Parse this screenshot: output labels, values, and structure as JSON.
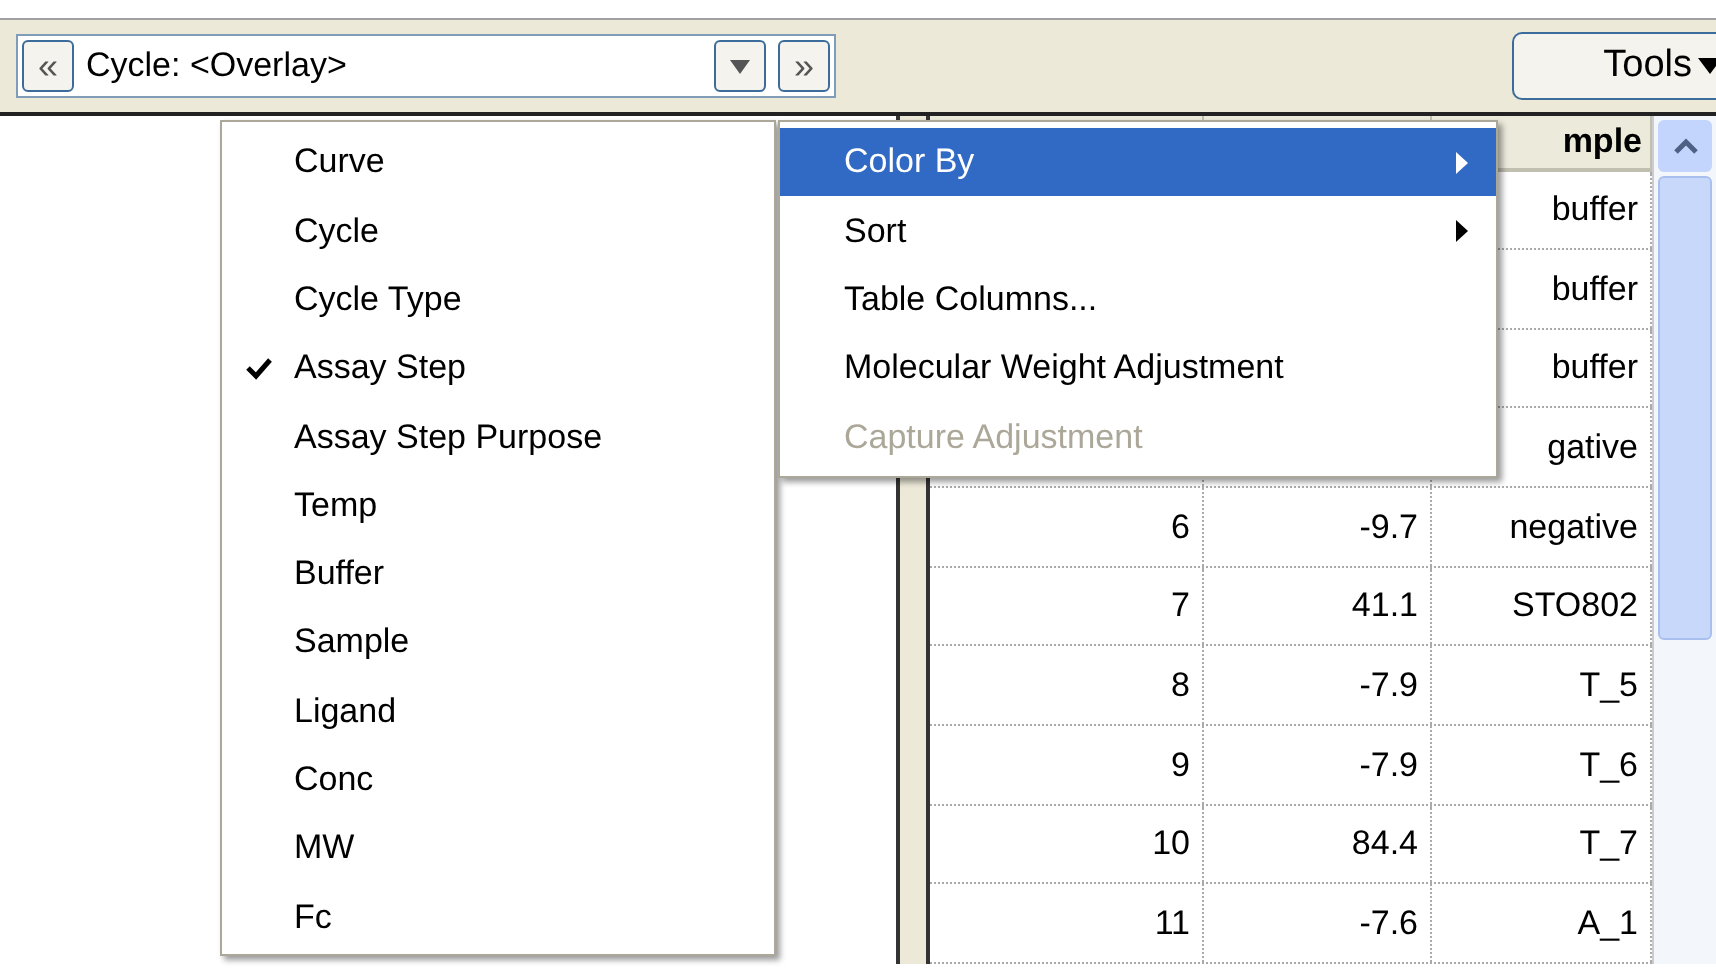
{
  "toolbar": {
    "prev_button": "«",
    "selector": {
      "value": "Cycle: <Overlay>"
    },
    "next_button": "»",
    "tools_button": "Tools"
  },
  "table": {
    "header": {
      "column_3": "mple"
    },
    "rows": [
      {
        "column_3": "buffer"
      },
      {
        "column_3": "buffer"
      },
      {
        "column_3": "buffer"
      },
      {
        "column_3": "gative"
      },
      {
        "column_1": "6",
        "column_2": "-9.7",
        "column_3": "negative"
      },
      {
        "column_1": "7",
        "column_2": "41.1",
        "column_3": "STO802"
      },
      {
        "column_1": "8",
        "column_2": "-7.9",
        "column_3": "T_5"
      },
      {
        "column_1": "9",
        "column_2": "-7.9",
        "column_3": "T_6"
      },
      {
        "column_1": "10",
        "column_2": "84.4",
        "column_3": "T_7"
      },
      {
        "column_1": "11",
        "column_2": "-7.6",
        "column_3": "A_1"
      }
    ]
  },
  "group_menu": [
    {
      "label": "Curve",
      "checked": false
    },
    {
      "label": "Cycle",
      "checked": false
    },
    {
      "label": "Cycle Type",
      "checked": false
    },
    {
      "label": "Assay Step",
      "checked": true
    },
    {
      "label": "Assay Step Purpose",
      "checked": false
    },
    {
      "label": "Temp",
      "checked": false
    },
    {
      "label": "Buffer",
      "checked": false
    },
    {
      "label": "Sample",
      "checked": false
    },
    {
      "label": "Ligand",
      "checked": false
    },
    {
      "label": "Conc",
      "checked": false
    },
    {
      "label": "MW",
      "checked": false
    },
    {
      "label": "Fc",
      "checked": false
    }
  ],
  "context_menu": [
    {
      "label": "Color By",
      "selected": true,
      "submenu": true,
      "disabled": false
    },
    {
      "label": "Sort",
      "selected": false,
      "submenu": true,
      "disabled": false
    },
    {
      "label": "Table Columns...",
      "selected": false,
      "submenu": false,
      "disabled": false
    },
    {
      "label": "Molecular Weight Adjustment",
      "selected": false,
      "submenu": false,
      "disabled": false
    },
    {
      "label": "Capture Adjustment",
      "selected": false,
      "submenu": false,
      "disabled": true
    }
  ]
}
